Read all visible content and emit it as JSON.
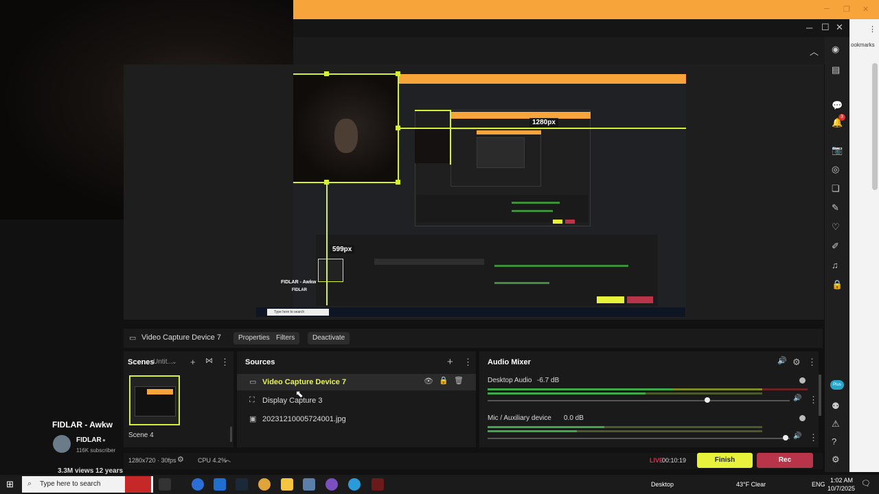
{
  "colors": {
    "accent_yellow": "#d6f03a",
    "rec_red": "#b83549",
    "obs_bg": "#1a1a1a",
    "browser_orange": "#f7a53a"
  },
  "preview": {
    "size_label_main": "1280px",
    "size_label_side": "599px",
    "mini_channel_title": "FIDLAR - Awkw",
    "mini_channel_name": "FIDLAR",
    "mini_search": "Type here to search"
  },
  "source_toolbar": {
    "current_source": "Video Capture Device 7",
    "properties_label": "Properties",
    "filters_label": "Filters",
    "deactivate_label": "Deactivate"
  },
  "scenes": {
    "title": "Scenes",
    "collection": "Untit...",
    "items": [
      {
        "label": "Scene 4"
      }
    ]
  },
  "sources": {
    "title": "Sources",
    "items": [
      {
        "label": "Video Capture Device 7",
        "icon": "camera-icon"
      },
      {
        "label": "Display Capture 3",
        "icon": "display-capture-icon"
      },
      {
        "label": "20231210005724001.jpg",
        "icon": "image-icon"
      }
    ]
  },
  "audio_mixer": {
    "title": "Audio Mixer",
    "channels": [
      {
        "name": "Desktop Audio",
        "level": "-6.7 dB",
        "volume": 0.78
      },
      {
        "name": "Mic / Auxiliary device",
        "level": "0.0 dB",
        "volume": 0.99
      }
    ]
  },
  "status_bar": {
    "resolution": "1280x720 · 30fps",
    "cpu": "CPU 4.2%",
    "live_label": "LIVE",
    "live_time": "00:10:19",
    "finish_label": "Finish",
    "rec_label": "Rec"
  },
  "youtube": {
    "title": "FIDLAR - Awkw",
    "channel": "FIDLAR",
    "subscribers": "116K subscriber",
    "views": "3.3M views  12 years"
  },
  "browser": {
    "bookmarks_label": "ookmarks",
    "plus_label": "Plus",
    "notification_count": "3"
  },
  "taskbar": {
    "search_placeholder": "Type here to search",
    "desktop_label": "Desktop",
    "weather": "43°F  Clear",
    "language": "ENG",
    "time": "1:02 AM",
    "date": "10/7/2025"
  }
}
